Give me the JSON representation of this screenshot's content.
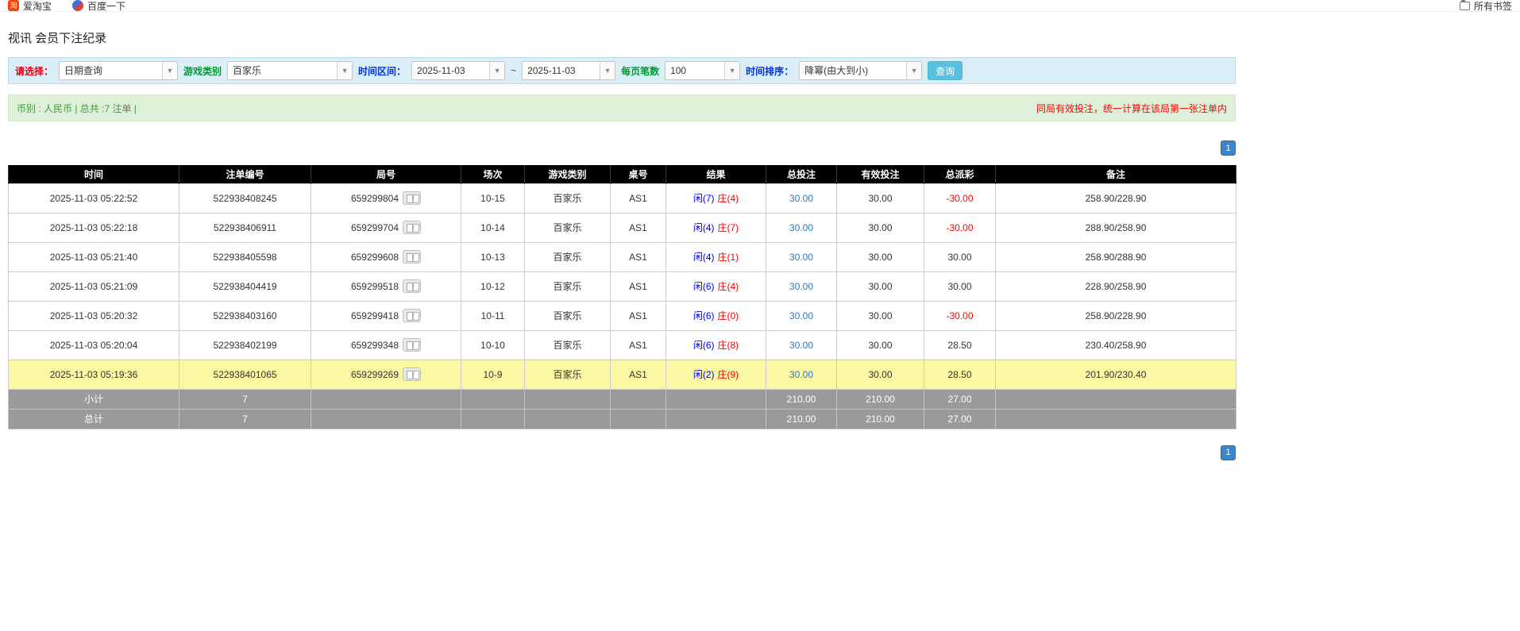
{
  "bookmarks_bar": {
    "items": [
      {
        "label": "爱淘宝",
        "icon": "taobao-icon"
      },
      {
        "label": "百度一下",
        "icon": "baidu-icon"
      }
    ],
    "all_bookmarks": {
      "label": "所有书签",
      "icon": "folder-icon"
    }
  },
  "page_title": "视讯 会员下注纪录",
  "filters": {
    "select_label": "请选择：",
    "select_value": "日期查询",
    "game_type_label": "游戏类别",
    "game_type_value": "百家乐",
    "time_range_label": "时间区间：",
    "time_from": "2025-11-03",
    "time_separator": "~",
    "time_to": "2025-11-03",
    "page_size_label": "每页笔数",
    "page_size_value": "100",
    "sort_label": "时间排序：",
    "sort_value": "降幂(由大到小)",
    "search_button": "查询"
  },
  "summary_bar": {
    "left_text": "币别 : 人民币 | 总共 :7 注单 |",
    "right_text": "同局有效投注，统一计算在该局第一张注单内"
  },
  "pagination": {
    "top": "1",
    "bottom": "1"
  },
  "table": {
    "headers": [
      "时间",
      "注单编号",
      "局号",
      "场次",
      "游戏类别",
      "桌号",
      "结果",
      "总投注",
      "有效投注",
      "总派彩",
      "备注"
    ],
    "rows": [
      {
        "time": "2025-11-03 05:22:52",
        "bet_id": "522938408245",
        "round_no": "659299804",
        "session": "10-15",
        "game": "百家乐",
        "table_no": "AS1",
        "result_player": "闲(7)",
        "result_banker": "庄(4)",
        "total_bet": "30.00",
        "valid_bet": "30.00",
        "payout": "-30.00",
        "note": "258.90/228.90",
        "highlight": false
      },
      {
        "time": "2025-11-03 05:22:18",
        "bet_id": "522938406911",
        "round_no": "659299704",
        "session": "10-14",
        "game": "百家乐",
        "table_no": "AS1",
        "result_player": "闲(4)",
        "result_banker": "庄(7)",
        "total_bet": "30.00",
        "valid_bet": "30.00",
        "payout": "-30.00",
        "note": "288.90/258.90",
        "highlight": false
      },
      {
        "time": "2025-11-03 05:21:40",
        "bet_id": "522938405598",
        "round_no": "659299608",
        "session": "10-13",
        "game": "百家乐",
        "table_no": "AS1",
        "result_player": "闲(4)",
        "result_banker": "庄(1)",
        "total_bet": "30.00",
        "valid_bet": "30.00",
        "payout": "30.00",
        "note": "258.90/288.90",
        "highlight": false
      },
      {
        "time": "2025-11-03 05:21:09",
        "bet_id": "522938404419",
        "round_no": "659299518",
        "session": "10-12",
        "game": "百家乐",
        "table_no": "AS1",
        "result_player": "闲(6)",
        "result_banker": "庄(4)",
        "total_bet": "30.00",
        "valid_bet": "30.00",
        "payout": "30.00",
        "note": "228.90/258.90",
        "highlight": false
      },
      {
        "time": "2025-11-03 05:20:32",
        "bet_id": "522938403160",
        "round_no": "659299418",
        "session": "10-11",
        "game": "百家乐",
        "table_no": "AS1",
        "result_player": "闲(6)",
        "result_banker": "庄(0)",
        "total_bet": "30.00",
        "valid_bet": "30.00",
        "payout": "-30.00",
        "note": "258.90/228.90",
        "highlight": false
      },
      {
        "time": "2025-11-03 05:20:04",
        "bet_id": "522938402199",
        "round_no": "659299348",
        "session": "10-10",
        "game": "百家乐",
        "table_no": "AS1",
        "result_player": "闲(6)",
        "result_banker": "庄(8)",
        "total_bet": "30.00",
        "valid_bet": "30.00",
        "payout": "28.50",
        "note": "230.40/258.90",
        "highlight": false
      },
      {
        "time": "2025-11-03 05:19:36",
        "bet_id": "522938401065",
        "round_no": "659299269",
        "session": "10-9",
        "game": "百家乐",
        "table_no": "AS1",
        "result_player": "闲(2)",
        "result_banker": "庄(9)",
        "total_bet": "30.00",
        "valid_bet": "30.00",
        "payout": "28.50",
        "note": "201.90/230.40",
        "highlight": true
      }
    ],
    "footer": [
      {
        "label": "小计",
        "count": "7",
        "total_bet": "210.00",
        "valid_bet": "210.00",
        "payout": "27.00"
      },
      {
        "label": "总计",
        "count": "7",
        "total_bet": "210.00",
        "valid_bet": "210.00",
        "payout": "27.00"
      }
    ],
    "round_detail_icon": "cards-icon"
  },
  "colors": {
    "header_bg": "#000000",
    "highlight_row": "#fbf8a3",
    "summary_row_bg": "#9a9a9a",
    "player_blue": "#0000ee",
    "banker_red": "#ee0000",
    "negative_red": "#ff0000",
    "link_blue": "#2a7ab9",
    "filter_bar_bg": "#dbeef7",
    "summary_bar_bg": "#dff0d8",
    "search_button_bg": "#5bc0de"
  }
}
